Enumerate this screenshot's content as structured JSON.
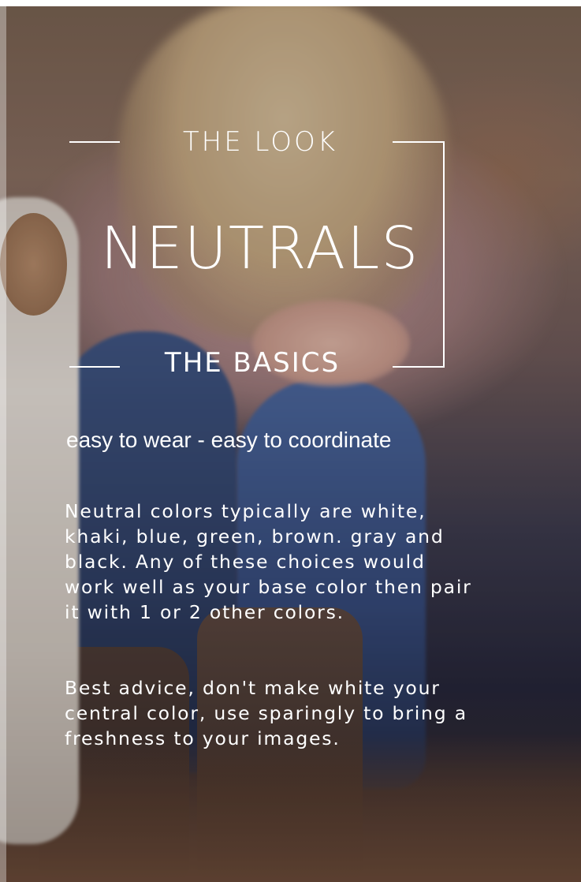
{
  "header": {
    "kicker": "THE LOOK",
    "title": "NEUTRALS",
    "subtitle": "THE BASICS"
  },
  "tagline": "easy to wear - easy to coordinate",
  "body": {
    "paragraph_1": "Neutral colors typically are white, khaki, blue, green, brown. gray and black.  Any of these choices would work well as your base color then pair it with 1 or 2 other colors.",
    "paragraph_2": "Best advice, don't make white your central color, use sparingly to bring a freshness to your images."
  },
  "colors": {
    "text": "#ffffff",
    "frame": "#ffffff"
  }
}
